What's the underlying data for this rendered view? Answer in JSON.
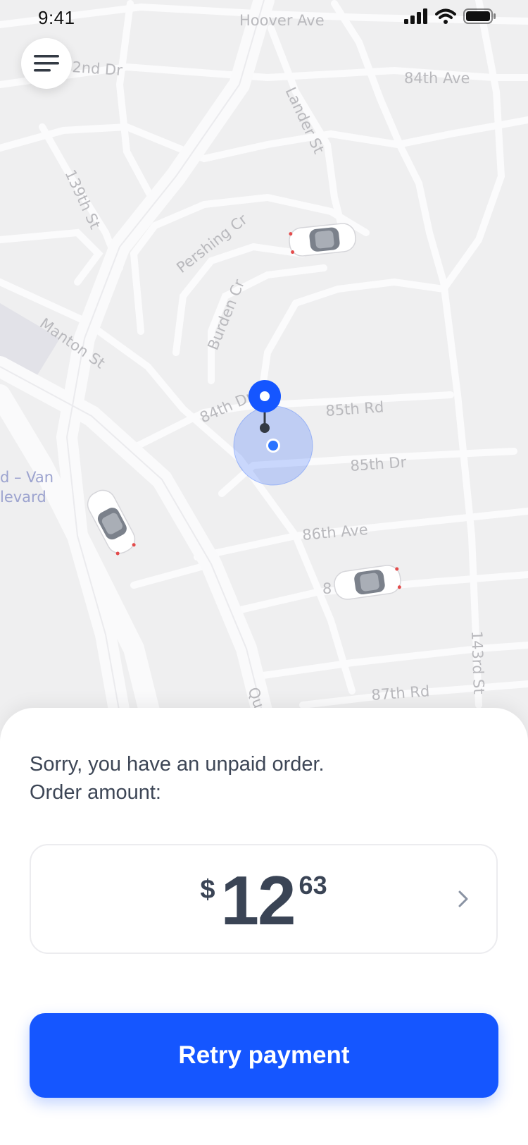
{
  "status_bar": {
    "time": "9:41"
  },
  "map": {
    "streets": [
      "Hoover Ave",
      "2nd Dr",
      "84th Ave",
      "Lander St",
      "139th St",
      "Pershing Cr",
      "Burden Cr",
      "Manton St",
      "84th Dr",
      "85th Rd",
      "85th Dr",
      "86th Ave",
      "8",
      "87th Rd",
      "143rd St",
      "Qu"
    ],
    "place_label": [
      "d – Van",
      "levard"
    ],
    "accent_color": "#1556ff"
  },
  "sheet": {
    "message_line1": "Sorry, you have an unpaid order.",
    "message_line2": "Order amount:",
    "amount": {
      "currency": "$",
      "whole": "12",
      "cents": "63"
    },
    "retry_label": "Retry payment"
  },
  "icons": {
    "menu": "menu-icon",
    "chevron": "chevron-right-icon",
    "signal": "signal-icon",
    "wifi": "wifi-icon",
    "battery": "battery-icon",
    "car": "car-icon",
    "pin": "location-pin-icon"
  }
}
